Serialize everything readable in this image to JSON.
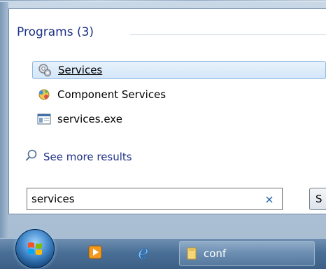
{
  "section": {
    "title": "Programs (3)"
  },
  "results": [
    {
      "label": "Services",
      "icon": "services-gear-icon"
    },
    {
      "label": "Component Services",
      "icon": "component-services-icon"
    },
    {
      "label": "services.exe",
      "icon": "console-window-icon"
    }
  ],
  "see_more": {
    "label": "See more results",
    "icon": "search-magnifier-icon"
  },
  "search": {
    "value": "services",
    "placeholder": "",
    "clear_glyph": "×"
  },
  "shutdown": {
    "label": "S"
  },
  "taskbar": {
    "items": [
      {
        "label": "conf",
        "icon": "folder-icon"
      }
    ]
  },
  "colors": {
    "accent": "#1e3287",
    "selection_bg": "#d3e6f8",
    "taskbar": "#4a6f96"
  }
}
